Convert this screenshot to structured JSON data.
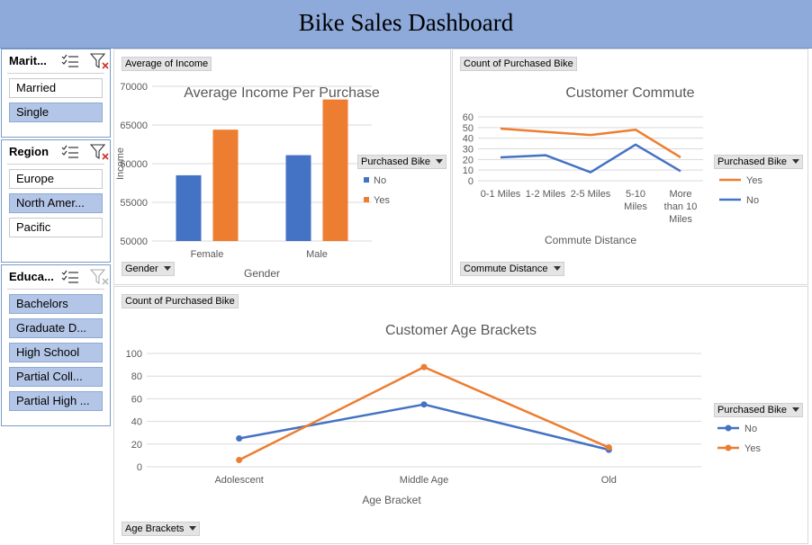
{
  "dashboard": {
    "title": "Bike Sales Dashboard"
  },
  "slicers": {
    "marital": {
      "title": "Marit...",
      "items": [
        {
          "label": "Married",
          "selected": false
        },
        {
          "label": "Single",
          "selected": true
        }
      ]
    },
    "region": {
      "title": "Region",
      "items": [
        {
          "label": "Europe",
          "selected": false
        },
        {
          "label": "North Amer...",
          "selected": true
        },
        {
          "label": "Pacific",
          "selected": false
        }
      ]
    },
    "education": {
      "title": "Educa...",
      "items": [
        {
          "label": "Bachelors",
          "selected": true
        },
        {
          "label": "Graduate D...",
          "selected": true
        },
        {
          "label": "High School",
          "selected": true
        },
        {
          "label": "Partial Coll...",
          "selected": true
        },
        {
          "label": "Partial High ...",
          "selected": true
        }
      ]
    }
  },
  "income_panel": {
    "value_button": "Average of Income",
    "axis_button": "Gender",
    "legend_button": "Purchased Bike"
  },
  "commute_panel": {
    "value_button": "Count of Purchased Bike",
    "axis_button": "Commute Distance",
    "legend_button": "Purchased Bike"
  },
  "age_panel": {
    "value_button": "Count of Purchased Bike",
    "axis_button": "Age Brackets",
    "legend_button": "Purchased Bike"
  },
  "chart_data": [
    {
      "type": "bar",
      "title": "Average Income Per Purchase",
      "xlabel": "Gender",
      "ylabel": "Income",
      "categories": [
        "Female",
        "Male"
      ],
      "series": [
        {
          "name": "No",
          "values": [
            58500,
            61100
          ]
        },
        {
          "name": "Yes",
          "values": [
            64400,
            68300
          ]
        }
      ],
      "ylim": [
        50000,
        70000
      ],
      "yticks": [
        "50000",
        "55000",
        "60000",
        "65000",
        "70000"
      ],
      "grid": true,
      "legend": "right",
      "colors": {
        "No": "#4472c4",
        "Yes": "#ed7d31"
      }
    },
    {
      "type": "line",
      "title": "Customer Commute",
      "xlabel": "Commute Distance",
      "ylabel": "",
      "categories": [
        "0-1 Miles",
        "1-2 Miles",
        "2-5 Miles",
        "5-10 Miles",
        "More than 10 Miles"
      ],
      "series": [
        {
          "name": "Yes",
          "values": [
            49,
            46,
            43,
            48,
            22
          ]
        },
        {
          "name": "No",
          "values": [
            22,
            24,
            8,
            34,
            9
          ]
        }
      ],
      "ylim": [
        0,
        60
      ],
      "yticks": [
        "0",
        "10",
        "20",
        "30",
        "40",
        "50",
        "60"
      ],
      "grid": true,
      "legend": "right",
      "colors": {
        "Yes": "#ed7d31",
        "No": "#4472c4"
      }
    },
    {
      "type": "line",
      "title": "Customer Age Brackets",
      "xlabel": "Age Bracket",
      "ylabel": "",
      "categories": [
        "Adolescent",
        "Middle Age",
        "Old"
      ],
      "series": [
        {
          "name": "No",
          "values": [
            25,
            55,
            15
          ]
        },
        {
          "name": "Yes",
          "values": [
            6,
            88,
            17
          ]
        }
      ],
      "ylim": [
        0,
        100
      ],
      "yticks": [
        "0",
        "20",
        "40",
        "60",
        "80",
        "100"
      ],
      "grid": true,
      "legend": "right",
      "markers": true,
      "colors": {
        "No": "#4472c4",
        "Yes": "#ed7d31"
      }
    }
  ]
}
